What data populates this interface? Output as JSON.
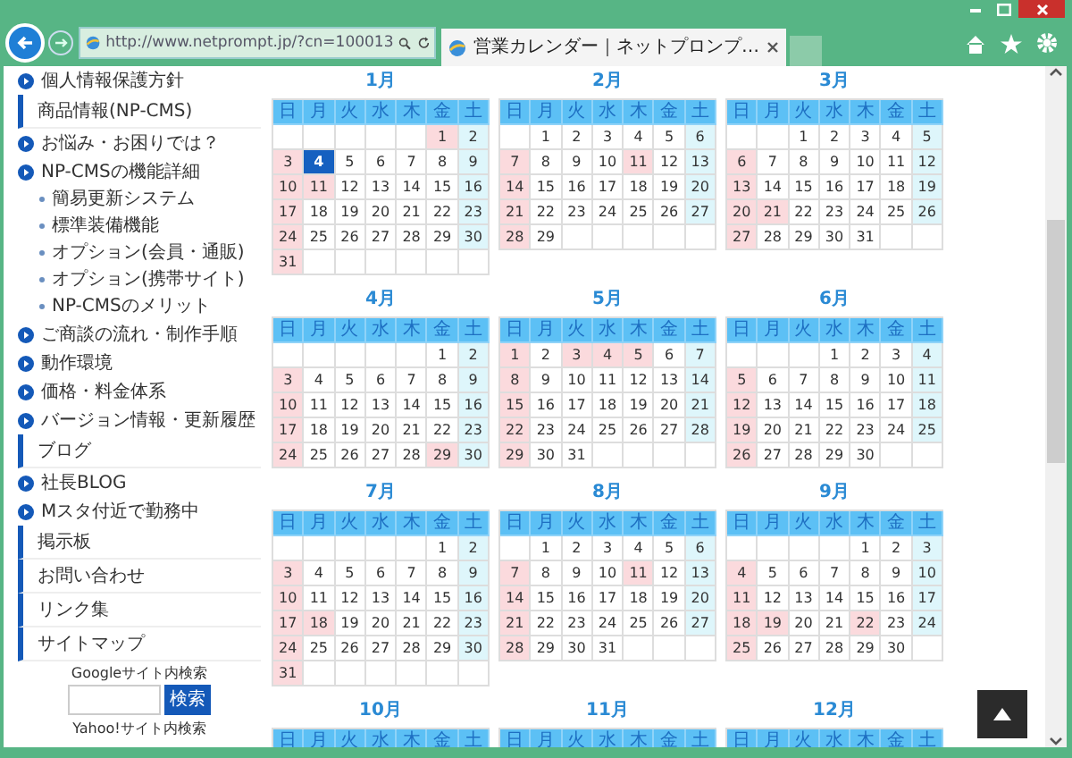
{
  "browser": {
    "address": "http://www.netprompt.jp/?cn=100013",
    "tab_title": "営業カレンダー｜ネットプロンプ…"
  },
  "sidebar": {
    "items": [
      {
        "kind": "link",
        "label": "個人情報保護方針"
      },
      {
        "kind": "section",
        "label": "商品情報(NP-CMS)"
      },
      {
        "kind": "link",
        "label": "お悩み・お困りでは？"
      },
      {
        "kind": "link",
        "label": "NP-CMSの機能詳細"
      },
      {
        "kind": "sub",
        "label": "簡易更新システム"
      },
      {
        "kind": "sub",
        "label": "標準装備機能"
      },
      {
        "kind": "sub",
        "label": "オプション(会員・通販)"
      },
      {
        "kind": "sub",
        "label": "オプション(携帯サイト)"
      },
      {
        "kind": "sub",
        "label": "NP-CMSのメリット"
      },
      {
        "kind": "link",
        "label": "ご商談の流れ・制作手順"
      },
      {
        "kind": "link",
        "label": "動作環境"
      },
      {
        "kind": "link",
        "label": "価格・料金体系"
      },
      {
        "kind": "link",
        "label": "バージョン情報・更新履歴"
      },
      {
        "kind": "section",
        "label": "ブログ"
      },
      {
        "kind": "link",
        "label": "社長BLOG"
      },
      {
        "kind": "link",
        "label": "Mスタ付近で勤務中"
      },
      {
        "kind": "section",
        "label": "掲示板"
      },
      {
        "kind": "section",
        "label": "お問い合わせ"
      },
      {
        "kind": "section",
        "label": "リンク集"
      },
      {
        "kind": "section",
        "label": "サイトマップ"
      }
    ],
    "search": {
      "label": "Googleサイト内検索",
      "button": "検索"
    },
    "search_2": {
      "label": "Yahoo!サイト内検索"
    }
  },
  "calendar": {
    "months": [
      {
        "title": "1月",
        "weekdays": [
          "日",
          "月",
          "火",
          "水",
          "木",
          "金",
          "土"
        ],
        "weeks": [
          [
            {
              "kind": "blank"
            },
            {
              "kind": "blank"
            },
            {
              "kind": "blank"
            },
            {
              "kind": "blank"
            },
            {
              "kind": "blank"
            },
            {
              "day": "1",
              "kind": "rest"
            },
            {
              "day": "2",
              "kind": "sat"
            }
          ],
          [
            {
              "day": "3",
              "kind": "rest"
            },
            {
              "day": "4",
              "kind": "today"
            },
            {
              "day": "5",
              "kind": "day"
            },
            {
              "day": "6",
              "kind": "day"
            },
            {
              "day": "7",
              "kind": "day"
            },
            {
              "day": "8",
              "kind": "day"
            },
            {
              "day": "9",
              "kind": "sat"
            }
          ],
          [
            {
              "day": "10",
              "kind": "rest"
            },
            {
              "day": "11",
              "kind": "rest"
            },
            {
              "day": "12",
              "kind": "day"
            },
            {
              "day": "13",
              "kind": "day"
            },
            {
              "day": "14",
              "kind": "day"
            },
            {
              "day": "15",
              "kind": "day"
            },
            {
              "day": "16",
              "kind": "sat"
            }
          ],
          [
            {
              "day": "17",
              "kind": "rest"
            },
            {
              "day": "18",
              "kind": "day"
            },
            {
              "day": "19",
              "kind": "day"
            },
            {
              "day": "20",
              "kind": "day"
            },
            {
              "day": "21",
              "kind": "day"
            },
            {
              "day": "22",
              "kind": "day"
            },
            {
              "day": "23",
              "kind": "sat"
            }
          ],
          [
            {
              "day": "24",
              "kind": "rest"
            },
            {
              "day": "25",
              "kind": "day"
            },
            {
              "day": "26",
              "kind": "day"
            },
            {
              "day": "27",
              "kind": "day"
            },
            {
              "day": "28",
              "kind": "day"
            },
            {
              "day": "29",
              "kind": "day"
            },
            {
              "day": "30",
              "kind": "sat"
            }
          ],
          [
            {
              "day": "31",
              "kind": "rest"
            },
            {
              "kind": "blank"
            },
            {
              "kind": "blank"
            },
            {
              "kind": "blank"
            },
            {
              "kind": "blank"
            },
            {
              "kind": "blank"
            },
            {
              "kind": "blank"
            }
          ]
        ]
      },
      {
        "title": "2月",
        "weekdays": [
          "日",
          "月",
          "火",
          "水",
          "木",
          "金",
          "土"
        ],
        "weeks": [
          [
            {
              "kind": "blank"
            },
            {
              "day": "1",
              "kind": "day"
            },
            {
              "day": "2",
              "kind": "day"
            },
            {
              "day": "3",
              "kind": "day"
            },
            {
              "day": "4",
              "kind": "day"
            },
            {
              "day": "5",
              "kind": "day"
            },
            {
              "day": "6",
              "kind": "sat"
            }
          ],
          [
            {
              "day": "7",
              "kind": "rest"
            },
            {
              "day": "8",
              "kind": "day"
            },
            {
              "day": "9",
              "kind": "day"
            },
            {
              "day": "10",
              "kind": "day"
            },
            {
              "day": "11",
              "kind": "rest"
            },
            {
              "day": "12",
              "kind": "day"
            },
            {
              "day": "13",
              "kind": "sat"
            }
          ],
          [
            {
              "day": "14",
              "kind": "rest"
            },
            {
              "day": "15",
              "kind": "day"
            },
            {
              "day": "16",
              "kind": "day"
            },
            {
              "day": "17",
              "kind": "day"
            },
            {
              "day": "18",
              "kind": "day"
            },
            {
              "day": "19",
              "kind": "day"
            },
            {
              "day": "20",
              "kind": "sat"
            }
          ],
          [
            {
              "day": "21",
              "kind": "rest"
            },
            {
              "day": "22",
              "kind": "day"
            },
            {
              "day": "23",
              "kind": "day"
            },
            {
              "day": "24",
              "kind": "day"
            },
            {
              "day": "25",
              "kind": "day"
            },
            {
              "day": "26",
              "kind": "day"
            },
            {
              "day": "27",
              "kind": "sat"
            }
          ],
          [
            {
              "day": "28",
              "kind": "rest"
            },
            {
              "day": "29",
              "kind": "day"
            },
            {
              "kind": "blank"
            },
            {
              "kind": "blank"
            },
            {
              "kind": "blank"
            },
            {
              "kind": "blank"
            },
            {
              "kind": "blank"
            }
          ]
        ]
      },
      {
        "title": "3月",
        "weekdays": [
          "日",
          "月",
          "火",
          "水",
          "木",
          "金",
          "土"
        ],
        "weeks": [
          [
            {
              "kind": "blank"
            },
            {
              "kind": "blank"
            },
            {
              "day": "1",
              "kind": "day"
            },
            {
              "day": "2",
              "kind": "day"
            },
            {
              "day": "3",
              "kind": "day"
            },
            {
              "day": "4",
              "kind": "day"
            },
            {
              "day": "5",
              "kind": "sat"
            }
          ],
          [
            {
              "day": "6",
              "kind": "rest"
            },
            {
              "day": "7",
              "kind": "day"
            },
            {
              "day": "8",
              "kind": "day"
            },
            {
              "day": "9",
              "kind": "day"
            },
            {
              "day": "10",
              "kind": "day"
            },
            {
              "day": "11",
              "kind": "day"
            },
            {
              "day": "12",
              "kind": "sat"
            }
          ],
          [
            {
              "day": "13",
              "kind": "rest"
            },
            {
              "day": "14",
              "kind": "day"
            },
            {
              "day": "15",
              "kind": "day"
            },
            {
              "day": "16",
              "kind": "day"
            },
            {
              "day": "17",
              "kind": "day"
            },
            {
              "day": "18",
              "kind": "day"
            },
            {
              "day": "19",
              "kind": "sat"
            }
          ],
          [
            {
              "day": "20",
              "kind": "rest"
            },
            {
              "day": "21",
              "kind": "rest"
            },
            {
              "day": "22",
              "kind": "day"
            },
            {
              "day": "23",
              "kind": "day"
            },
            {
              "day": "24",
              "kind": "day"
            },
            {
              "day": "25",
              "kind": "day"
            },
            {
              "day": "26",
              "kind": "sat"
            }
          ],
          [
            {
              "day": "27",
              "kind": "rest"
            },
            {
              "day": "28",
              "kind": "day"
            },
            {
              "day": "29",
              "kind": "day"
            },
            {
              "day": "30",
              "kind": "day"
            },
            {
              "day": "31",
              "kind": "day"
            },
            {
              "kind": "blank"
            },
            {
              "kind": "blank"
            }
          ]
        ]
      },
      {
        "title": "4月",
        "weekdays": [
          "日",
          "月",
          "火",
          "水",
          "木",
          "金",
          "土"
        ],
        "weeks": [
          [
            {
              "kind": "blank"
            },
            {
              "kind": "blank"
            },
            {
              "kind": "blank"
            },
            {
              "kind": "blank"
            },
            {
              "kind": "blank"
            },
            {
              "day": "1",
              "kind": "day"
            },
            {
              "day": "2",
              "kind": "sat"
            }
          ],
          [
            {
              "day": "3",
              "kind": "rest"
            },
            {
              "day": "4",
              "kind": "day"
            },
            {
              "day": "5",
              "kind": "day"
            },
            {
              "day": "6",
              "kind": "day"
            },
            {
              "day": "7",
              "kind": "day"
            },
            {
              "day": "8",
              "kind": "day"
            },
            {
              "day": "9",
              "kind": "sat"
            }
          ],
          [
            {
              "day": "10",
              "kind": "rest"
            },
            {
              "day": "11",
              "kind": "day"
            },
            {
              "day": "12",
              "kind": "day"
            },
            {
              "day": "13",
              "kind": "day"
            },
            {
              "day": "14",
              "kind": "day"
            },
            {
              "day": "15",
              "kind": "day"
            },
            {
              "day": "16",
              "kind": "sat"
            }
          ],
          [
            {
              "day": "17",
              "kind": "rest"
            },
            {
              "day": "18",
              "kind": "day"
            },
            {
              "day": "19",
              "kind": "day"
            },
            {
              "day": "20",
              "kind": "day"
            },
            {
              "day": "21",
              "kind": "day"
            },
            {
              "day": "22",
              "kind": "day"
            },
            {
              "day": "23",
              "kind": "sat"
            }
          ],
          [
            {
              "day": "24",
              "kind": "rest"
            },
            {
              "day": "25",
              "kind": "day"
            },
            {
              "day": "26",
              "kind": "day"
            },
            {
              "day": "27",
              "kind": "day"
            },
            {
              "day": "28",
              "kind": "day"
            },
            {
              "day": "29",
              "kind": "rest"
            },
            {
              "day": "30",
              "kind": "sat"
            }
          ]
        ]
      },
      {
        "title": "5月",
        "weekdays": [
          "日",
          "月",
          "火",
          "水",
          "木",
          "金",
          "土"
        ],
        "weeks": [
          [
            {
              "day": "1",
              "kind": "rest"
            },
            {
              "day": "2",
              "kind": "day"
            },
            {
              "day": "3",
              "kind": "rest"
            },
            {
              "day": "4",
              "kind": "rest"
            },
            {
              "day": "5",
              "kind": "rest"
            },
            {
              "day": "6",
              "kind": "day"
            },
            {
              "day": "7",
              "kind": "sat"
            }
          ],
          [
            {
              "day": "8",
              "kind": "rest"
            },
            {
              "day": "9",
              "kind": "day"
            },
            {
              "day": "10",
              "kind": "day"
            },
            {
              "day": "11",
              "kind": "day"
            },
            {
              "day": "12",
              "kind": "day"
            },
            {
              "day": "13",
              "kind": "day"
            },
            {
              "day": "14",
              "kind": "sat"
            }
          ],
          [
            {
              "day": "15",
              "kind": "rest"
            },
            {
              "day": "16",
              "kind": "day"
            },
            {
              "day": "17",
              "kind": "day"
            },
            {
              "day": "18",
              "kind": "day"
            },
            {
              "day": "19",
              "kind": "day"
            },
            {
              "day": "20",
              "kind": "day"
            },
            {
              "day": "21",
              "kind": "sat"
            }
          ],
          [
            {
              "day": "22",
              "kind": "rest"
            },
            {
              "day": "23",
              "kind": "day"
            },
            {
              "day": "24",
              "kind": "day"
            },
            {
              "day": "25",
              "kind": "day"
            },
            {
              "day": "26",
              "kind": "day"
            },
            {
              "day": "27",
              "kind": "day"
            },
            {
              "day": "28",
              "kind": "sat"
            }
          ],
          [
            {
              "day": "29",
              "kind": "rest"
            },
            {
              "day": "30",
              "kind": "day"
            },
            {
              "day": "31",
              "kind": "day"
            },
            {
              "kind": "blank"
            },
            {
              "kind": "blank"
            },
            {
              "kind": "blank"
            },
            {
              "kind": "blank"
            }
          ]
        ]
      },
      {
        "title": "6月",
        "weekdays": [
          "日",
          "月",
          "火",
          "水",
          "木",
          "金",
          "土"
        ],
        "weeks": [
          [
            {
              "kind": "blank"
            },
            {
              "kind": "blank"
            },
            {
              "kind": "blank"
            },
            {
              "day": "1",
              "kind": "day"
            },
            {
              "day": "2",
              "kind": "day"
            },
            {
              "day": "3",
              "kind": "day"
            },
            {
              "day": "4",
              "kind": "sat"
            }
          ],
          [
            {
              "day": "5",
              "kind": "rest"
            },
            {
              "day": "6",
              "kind": "day"
            },
            {
              "day": "7",
              "kind": "day"
            },
            {
              "day": "8",
              "kind": "day"
            },
            {
              "day": "9",
              "kind": "day"
            },
            {
              "day": "10",
              "kind": "day"
            },
            {
              "day": "11",
              "kind": "sat"
            }
          ],
          [
            {
              "day": "12",
              "kind": "rest"
            },
            {
              "day": "13",
              "kind": "day"
            },
            {
              "day": "14",
              "kind": "day"
            },
            {
              "day": "15",
              "kind": "day"
            },
            {
              "day": "16",
              "kind": "day"
            },
            {
              "day": "17",
              "kind": "day"
            },
            {
              "day": "18",
              "kind": "sat"
            }
          ],
          [
            {
              "day": "19",
              "kind": "rest"
            },
            {
              "day": "20",
              "kind": "day"
            },
            {
              "day": "21",
              "kind": "day"
            },
            {
              "day": "22",
              "kind": "day"
            },
            {
              "day": "23",
              "kind": "day"
            },
            {
              "day": "24",
              "kind": "day"
            },
            {
              "day": "25",
              "kind": "sat"
            }
          ],
          [
            {
              "day": "26",
              "kind": "rest"
            },
            {
              "day": "27",
              "kind": "day"
            },
            {
              "day": "28",
              "kind": "day"
            },
            {
              "day": "29",
              "kind": "day"
            },
            {
              "day": "30",
              "kind": "day"
            },
            {
              "kind": "blank"
            },
            {
              "kind": "blank"
            }
          ]
        ]
      },
      {
        "title": "7月",
        "weekdays": [
          "日",
          "月",
          "火",
          "水",
          "木",
          "金",
          "土"
        ],
        "weeks": [
          [
            {
              "kind": "blank"
            },
            {
              "kind": "blank"
            },
            {
              "kind": "blank"
            },
            {
              "kind": "blank"
            },
            {
              "kind": "blank"
            },
            {
              "day": "1",
              "kind": "day"
            },
            {
              "day": "2",
              "kind": "sat"
            }
          ],
          [
            {
              "day": "3",
              "kind": "rest"
            },
            {
              "day": "4",
              "kind": "day"
            },
            {
              "day": "5",
              "kind": "day"
            },
            {
              "day": "6",
              "kind": "day"
            },
            {
              "day": "7",
              "kind": "day"
            },
            {
              "day": "8",
              "kind": "day"
            },
            {
              "day": "9",
              "kind": "sat"
            }
          ],
          [
            {
              "day": "10",
              "kind": "rest"
            },
            {
              "day": "11",
              "kind": "day"
            },
            {
              "day": "12",
              "kind": "day"
            },
            {
              "day": "13",
              "kind": "day"
            },
            {
              "day": "14",
              "kind": "day"
            },
            {
              "day": "15",
              "kind": "day"
            },
            {
              "day": "16",
              "kind": "sat"
            }
          ],
          [
            {
              "day": "17",
              "kind": "rest"
            },
            {
              "day": "18",
              "kind": "rest"
            },
            {
              "day": "19",
              "kind": "day"
            },
            {
              "day": "20",
              "kind": "day"
            },
            {
              "day": "21",
              "kind": "day"
            },
            {
              "day": "22",
              "kind": "day"
            },
            {
              "day": "23",
              "kind": "sat"
            }
          ],
          [
            {
              "day": "24",
              "kind": "rest"
            },
            {
              "day": "25",
              "kind": "day"
            },
            {
              "day": "26",
              "kind": "day"
            },
            {
              "day": "27",
              "kind": "day"
            },
            {
              "day": "28",
              "kind": "day"
            },
            {
              "day": "29",
              "kind": "day"
            },
            {
              "day": "30",
              "kind": "sat"
            }
          ],
          [
            {
              "day": "31",
              "kind": "rest"
            },
            {
              "kind": "blank"
            },
            {
              "kind": "blank"
            },
            {
              "kind": "blank"
            },
            {
              "kind": "blank"
            },
            {
              "kind": "blank"
            },
            {
              "kind": "blank"
            }
          ]
        ]
      },
      {
        "title": "8月",
        "weekdays": [
          "日",
          "月",
          "火",
          "水",
          "木",
          "金",
          "土"
        ],
        "weeks": [
          [
            {
              "kind": "blank"
            },
            {
              "day": "1",
              "kind": "day"
            },
            {
              "day": "2",
              "kind": "day"
            },
            {
              "day": "3",
              "kind": "day"
            },
            {
              "day": "4",
              "kind": "day"
            },
            {
              "day": "5",
              "kind": "day"
            },
            {
              "day": "6",
              "kind": "sat"
            }
          ],
          [
            {
              "day": "7",
              "kind": "rest"
            },
            {
              "day": "8",
              "kind": "day"
            },
            {
              "day": "9",
              "kind": "day"
            },
            {
              "day": "10",
              "kind": "day"
            },
            {
              "day": "11",
              "kind": "rest"
            },
            {
              "day": "12",
              "kind": "day"
            },
            {
              "day": "13",
              "kind": "sat"
            }
          ],
          [
            {
              "day": "14",
              "kind": "rest"
            },
            {
              "day": "15",
              "kind": "day"
            },
            {
              "day": "16",
              "kind": "day"
            },
            {
              "day": "17",
              "kind": "day"
            },
            {
              "day": "18",
              "kind": "day"
            },
            {
              "day": "19",
              "kind": "day"
            },
            {
              "day": "20",
              "kind": "sat"
            }
          ],
          [
            {
              "day": "21",
              "kind": "rest"
            },
            {
              "day": "22",
              "kind": "day"
            },
            {
              "day": "23",
              "kind": "day"
            },
            {
              "day": "24",
              "kind": "day"
            },
            {
              "day": "25",
              "kind": "day"
            },
            {
              "day": "26",
              "kind": "day"
            },
            {
              "day": "27",
              "kind": "sat"
            }
          ],
          [
            {
              "day": "28",
              "kind": "rest"
            },
            {
              "day": "29",
              "kind": "day"
            },
            {
              "day": "30",
              "kind": "day"
            },
            {
              "day": "31",
              "kind": "day"
            },
            {
              "kind": "blank"
            },
            {
              "kind": "blank"
            },
            {
              "kind": "blank"
            }
          ]
        ]
      },
      {
        "title": "9月",
        "weekdays": [
          "日",
          "月",
          "火",
          "水",
          "木",
          "金",
          "土"
        ],
        "weeks": [
          [
            {
              "kind": "blank"
            },
            {
              "kind": "blank"
            },
            {
              "kind": "blank"
            },
            {
              "kind": "blank"
            },
            {
              "day": "1",
              "kind": "day"
            },
            {
              "day": "2",
              "kind": "day"
            },
            {
              "day": "3",
              "kind": "sat"
            }
          ],
          [
            {
              "day": "4",
              "kind": "rest"
            },
            {
              "day": "5",
              "kind": "day"
            },
            {
              "day": "6",
              "kind": "day"
            },
            {
              "day": "7",
              "kind": "day"
            },
            {
              "day": "8",
              "kind": "day"
            },
            {
              "day": "9",
              "kind": "day"
            },
            {
              "day": "10",
              "kind": "sat"
            }
          ],
          [
            {
              "day": "11",
              "kind": "rest"
            },
            {
              "day": "12",
              "kind": "day"
            },
            {
              "day": "13",
              "kind": "day"
            },
            {
              "day": "14",
              "kind": "day"
            },
            {
              "day": "15",
              "kind": "day"
            },
            {
              "day": "16",
              "kind": "day"
            },
            {
              "day": "17",
              "kind": "sat"
            }
          ],
          [
            {
              "day": "18",
              "kind": "rest"
            },
            {
              "day": "19",
              "kind": "rest"
            },
            {
              "day": "20",
              "kind": "day"
            },
            {
              "day": "21",
              "kind": "day"
            },
            {
              "day": "22",
              "kind": "rest"
            },
            {
              "day": "23",
              "kind": "day"
            },
            {
              "day": "24",
              "kind": "sat"
            }
          ],
          [
            {
              "day": "25",
              "kind": "rest"
            },
            {
              "day": "26",
              "kind": "day"
            },
            {
              "day": "27",
              "kind": "day"
            },
            {
              "day": "28",
              "kind": "day"
            },
            {
              "day": "29",
              "kind": "day"
            },
            {
              "day": "30",
              "kind": "day"
            },
            {
              "kind": "blank"
            }
          ]
        ]
      },
      {
        "title": "10月",
        "weekdays": [
          "日",
          "月",
          "火",
          "水",
          "木",
          "金",
          "土"
        ]
      },
      {
        "title": "11月",
        "weekdays": [
          "日",
          "月",
          "火",
          "水",
          "木",
          "金",
          "土"
        ]
      },
      {
        "title": "12月",
        "weekdays": [
          "日",
          "月",
          "火",
          "水",
          "木",
          "金",
          "土"
        ]
      }
    ]
  }
}
